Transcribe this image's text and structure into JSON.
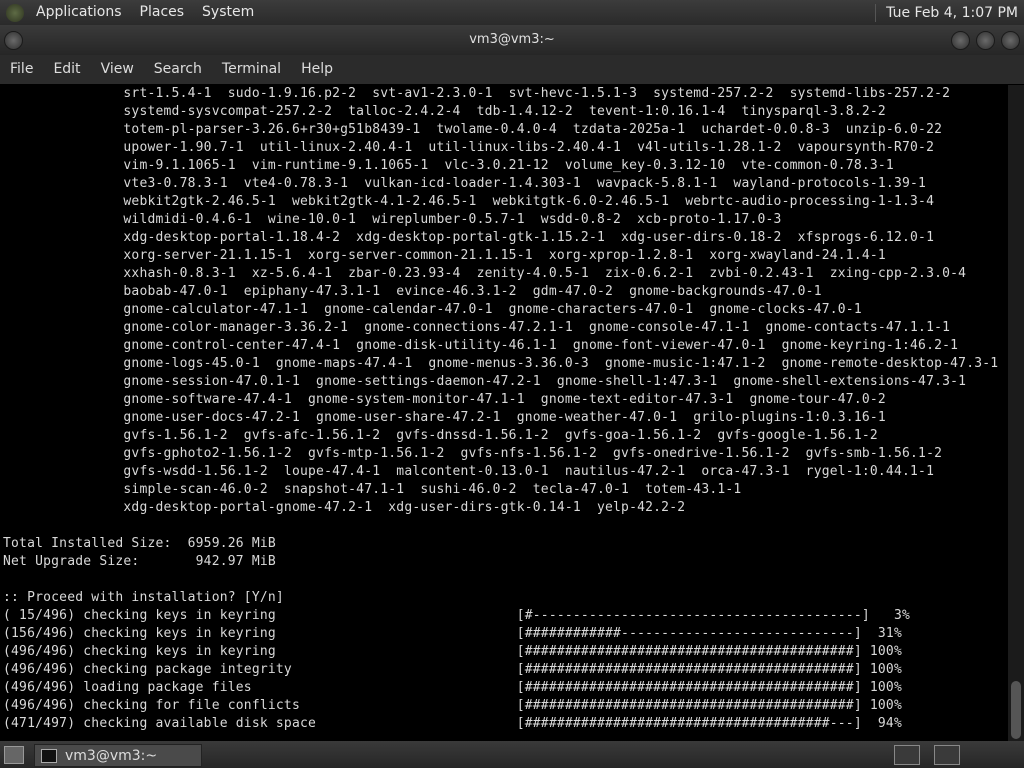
{
  "top_panel": {
    "menus": [
      "Applications",
      "Places",
      "System"
    ],
    "clock": "Tue Feb  4,  1:07 PM"
  },
  "window": {
    "title": "vm3@vm3:~"
  },
  "menubar": [
    "File",
    "Edit",
    "View",
    "Search",
    "Terminal",
    "Help"
  ],
  "terminal": {
    "lines": [
      "               srt-1.5.4-1  sudo-1.9.16.p2-2  svt-av1-2.3.0-1  svt-hevc-1.5.1-3  systemd-257.2-2  systemd-libs-257.2-2",
      "               systemd-sysvcompat-257.2-2  talloc-2.4.2-4  tdb-1.4.12-2  tevent-1:0.16.1-4  tinysparql-3.8.2-2",
      "               totem-pl-parser-3.26.6+r30+g51b8439-1  twolame-0.4.0-4  tzdata-2025a-1  uchardet-0.0.8-3  unzip-6.0-22",
      "               upower-1.90.7-1  util-linux-2.40.4-1  util-linux-libs-2.40.4-1  v4l-utils-1.28.1-2  vapoursynth-R70-2",
      "               vim-9.1.1065-1  vim-runtime-9.1.1065-1  vlc-3.0.21-12  volume_key-0.3.12-10  vte-common-0.78.3-1",
      "               vte3-0.78.3-1  vte4-0.78.3-1  vulkan-icd-loader-1.4.303-1  wavpack-5.8.1-1  wayland-protocols-1.39-1",
      "               webkit2gtk-2.46.5-1  webkit2gtk-4.1-2.46.5-1  webkitgtk-6.0-2.46.5-1  webrtc-audio-processing-1-1.3-4",
      "               wildmidi-0.4.6-1  wine-10.0-1  wireplumber-0.5.7-1  wsdd-0.8-2  xcb-proto-1.17.0-3",
      "               xdg-desktop-portal-1.18.4-2  xdg-desktop-portal-gtk-1.15.2-1  xdg-user-dirs-0.18-2  xfsprogs-6.12.0-1",
      "               xorg-server-21.1.15-1  xorg-server-common-21.1.15-1  xorg-xprop-1.2.8-1  xorg-xwayland-24.1.4-1",
      "               xxhash-0.8.3-1  xz-5.6.4-1  zbar-0.23.93-4  zenity-4.0.5-1  zix-0.6.2-1  zvbi-0.2.43-1  zxing-cpp-2.3.0-4",
      "               baobab-47.0-1  epiphany-47.3.1-1  evince-46.3.1-2  gdm-47.0-2  gnome-backgrounds-47.0-1",
      "               gnome-calculator-47.1-1  gnome-calendar-47.0-1  gnome-characters-47.0-1  gnome-clocks-47.0-1",
      "               gnome-color-manager-3.36.2-1  gnome-connections-47.2.1-1  gnome-console-47.1-1  gnome-contacts-47.1.1-1",
      "               gnome-control-center-47.4-1  gnome-disk-utility-46.1-1  gnome-font-viewer-47.0-1  gnome-keyring-1:46.2-1",
      "               gnome-logs-45.0-1  gnome-maps-47.4-1  gnome-menus-3.36.0-3  gnome-music-1:47.1-2  gnome-remote-desktop-47.3-1",
      "               gnome-session-47.0.1-1  gnome-settings-daemon-47.2-1  gnome-shell-1:47.3-1  gnome-shell-extensions-47.3-1",
      "               gnome-software-47.4-1  gnome-system-monitor-47.1-1  gnome-text-editor-47.3-1  gnome-tour-47.0-2",
      "               gnome-user-docs-47.2-1  gnome-user-share-47.2-1  gnome-weather-47.0-1  grilo-plugins-1:0.3.16-1",
      "               gvfs-1.56.1-2  gvfs-afc-1.56.1-2  gvfs-dnssd-1.56.1-2  gvfs-goa-1.56.1-2  gvfs-google-1.56.1-2",
      "               gvfs-gphoto2-1.56.1-2  gvfs-mtp-1.56.1-2  gvfs-nfs-1.56.1-2  gvfs-onedrive-1.56.1-2  gvfs-smb-1.56.1-2",
      "               gvfs-wsdd-1.56.1-2  loupe-47.4-1  malcontent-0.13.0-1  nautilus-47.2-1  orca-47.3-1  rygel-1:0.44.1-1",
      "               simple-scan-46.0-2  snapshot-47.1-1  sushi-46.0-2  tecla-47.0-1  totem-43.1-1",
      "               xdg-desktop-portal-gnome-47.2-1  xdg-user-dirs-gtk-0.14-1  yelp-42.2-2",
      "",
      "Total Installed Size:  6959.26 MiB",
      "Net Upgrade Size:       942.97 MiB",
      "",
      ":: Proceed with installation? [Y/n]",
      "( 15/496) checking keys in keyring                              [#-----------------------------------------]   3%",
      "(156/496) checking keys in keyring                              [############-----------------------------]  31%",
      "(496/496) checking keys in keyring                              [#########################################] 100%",
      "(496/496) checking package integrity                            [#########################################] 100%",
      "(496/496) loading package files                                 [#########################################] 100%",
      "(496/496) checking for file conflicts                           [#########################################] 100%",
      "(471/497) checking available disk space                         [######################################---]  94%"
    ]
  },
  "taskbar": {
    "task_label": "vm3@vm3:~"
  }
}
